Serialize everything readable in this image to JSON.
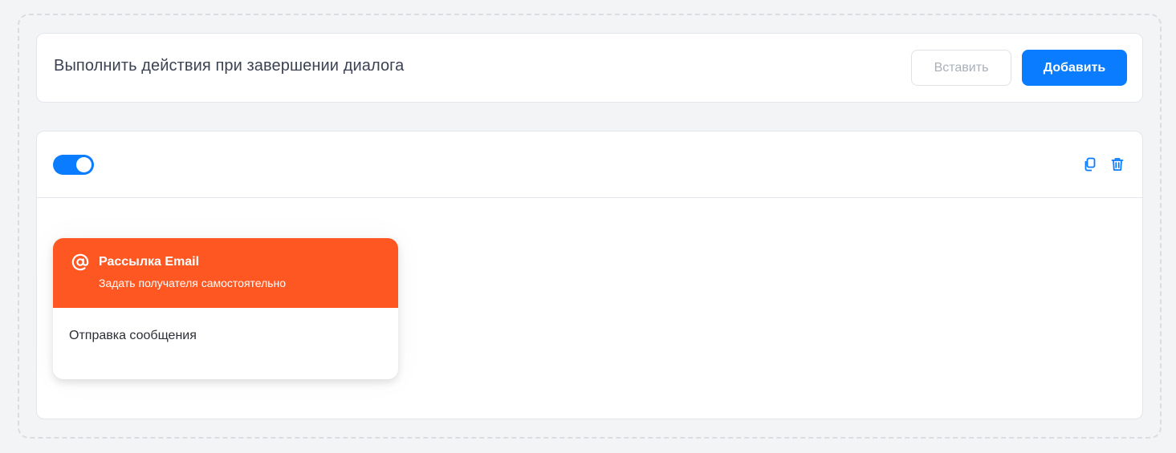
{
  "header": {
    "title": "Выполнить действия при завершении диалога",
    "paste_label": "Вставить",
    "add_label": "Добавить"
  },
  "rule": {
    "enabled": true,
    "toolbar_icons": [
      "copy-icon",
      "trash-icon"
    ],
    "action": {
      "icon": "at-sign-icon",
      "title": "Рассылка Email",
      "subtitle": "Задать получателя самостоятельно",
      "body": "Отправка сообщения"
    }
  },
  "colors": {
    "accent": "#0a7cff",
    "action_header": "#ff5722",
    "background": "#f3f4f6"
  }
}
